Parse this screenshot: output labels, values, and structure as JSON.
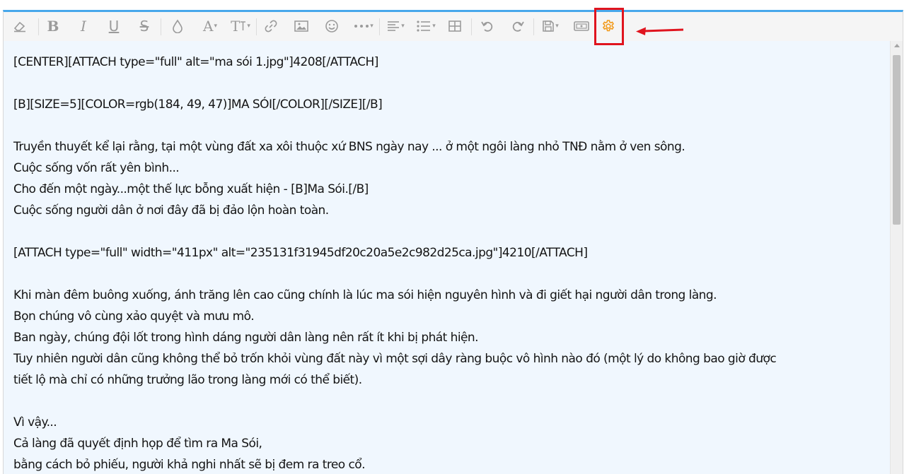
{
  "toolbar": {
    "buttons": [
      {
        "name": "eraser-icon"
      },
      {
        "name": "bold-icon",
        "glyph": "B"
      },
      {
        "name": "italic-icon",
        "glyph": "I"
      },
      {
        "name": "underline-icon",
        "glyph": "U"
      },
      {
        "name": "strikethrough-icon",
        "glyph": "S"
      },
      {
        "name": "color-drop-icon"
      },
      {
        "name": "font-family-icon",
        "glyph": "A"
      },
      {
        "name": "font-size-icon",
        "glyph": "T"
      },
      {
        "name": "link-icon"
      },
      {
        "name": "image-icon"
      },
      {
        "name": "smiley-icon"
      },
      {
        "name": "more-icon"
      },
      {
        "name": "align-icon"
      },
      {
        "name": "list-icon"
      },
      {
        "name": "table-icon"
      },
      {
        "name": "undo-icon"
      },
      {
        "name": "redo-icon"
      },
      {
        "name": "save-draft-icon"
      },
      {
        "name": "preview-icon"
      },
      {
        "name": "gear-icon"
      }
    ],
    "caret": "▾",
    "gear_color": "#f29b1d",
    "highlight_color": "#e0141e"
  },
  "content": {
    "lines": [
      "[CENTER][ATTACH type=\"full\" alt=\"ma sói 1.jpg\"]4208[/ATTACH]",
      "",
      "[B][SIZE=5][COLOR=rgb(184, 49, 47)]MA SÓI[/COLOR][/SIZE][/B]",
      "",
      "Truyền thuyết kể lại rằng, tại một vùng đất xa xôi thuộc xứ BNS ngày nay ... ở một ngôi làng nhỏ TNĐ nằm ở ven sông.",
      "Cuộc sống vốn rất yên bình...",
      "Cho đến một ngày...một thế lực bỗng xuất hiện - [B]Ma Sói.[/B]",
      "Cuộc sống người dân ở nơi đây đã bị đảo lộn hoàn toàn.",
      "",
      "[ATTACH type=\"full\" width=\"411px\" alt=\"235131f31945df20c20a5e2c982d25ca.jpg\"]4210[/ATTACH]",
      "",
      "Khi màn đêm buông xuống, ánh trăng lên cao cũng chính là lúc ma sói hiện nguyên hình và đi giết hại người dân trong làng.",
      "Bọn chúng vô cùng xảo quyệt và mưu mô.",
      "Ban ngày, chúng đội lốt trong hình dáng người dân làng nên rất ít khi bị phát hiện.",
      "Tuy nhiên người dân cũng không thể bỏ trốn khỏi vùng đất này vì một sợi dây ràng buộc vô hình nào đó (một lý do không bao giờ được",
      "tiết lộ mà chỉ có những trưởng lão trong làng mới có thể biết).",
      "",
      "Vì vậy...",
      "Cả làng đã quyết định họp để tìm ra Ma Sói,",
      "bằng cách bỏ phiếu, người khả nghi nhất sẽ bị đem ra treo cổ."
    ]
  }
}
